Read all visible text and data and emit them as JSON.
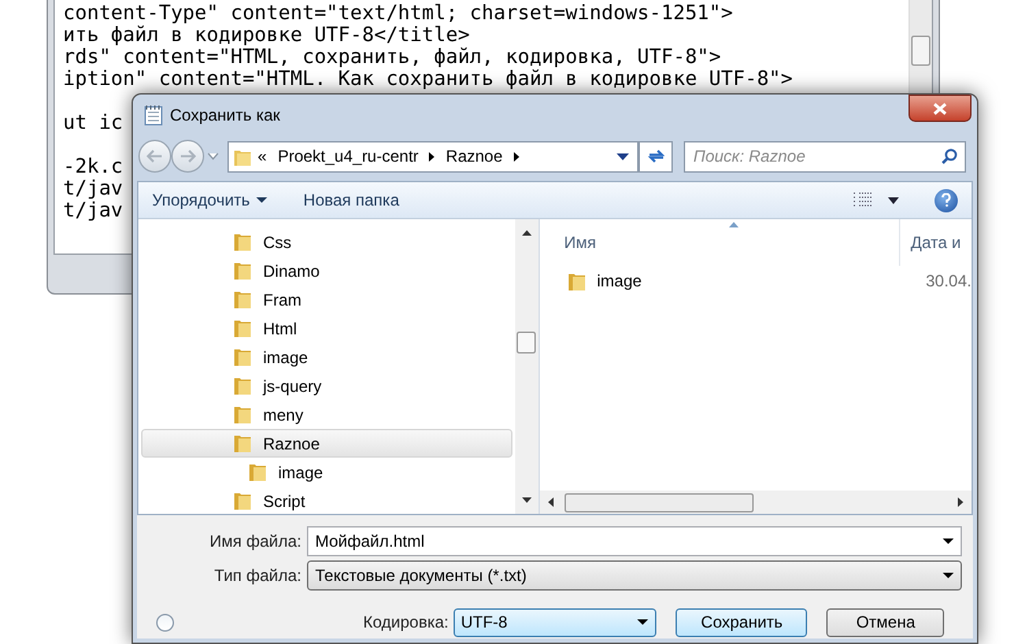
{
  "editor": {
    "lines": [
      {
        "kind": "code",
        "text": "content-Type\" content=\"text/html; charset=windows-1251\">"
      },
      {
        "kind": "code",
        "text": "ить файл в кодировке UTF-8</title>"
      },
      {
        "kind": "code",
        "text": "rds\" content=\"HTML, сохранить, файл, кодировка, UTF-8\">"
      },
      {
        "kind": "code",
        "text": "iption\" content=\"HTML. Как сохранить файл в кодировке UTF-8\">"
      },
      {
        "kind": "blank"
      },
      {
        "kind": "code",
        "text": "ut ic"
      },
      {
        "kind": "blank"
      },
      {
        "kind": "code",
        "text": "-2k.c"
      },
      {
        "kind": "code",
        "text": "t/jav"
      },
      {
        "kind": "code",
        "text": "t/jav"
      }
    ]
  },
  "dialog": {
    "title": "Сохранить как",
    "address": {
      "overflow": "«",
      "crumbs": [
        "Proekt_u4_ru-centr",
        "Raznoe"
      ]
    },
    "search": {
      "placeholder": "Поиск: Raznoe"
    },
    "toolbar": {
      "buttons": [
        "Упорядочить",
        "Новая папка"
      ]
    },
    "tree": [
      {
        "label": "Css",
        "selected": false
      },
      {
        "label": "Dinamo",
        "selected": false
      },
      {
        "label": "Fram",
        "selected": false
      },
      {
        "label": "Html",
        "selected": false
      },
      {
        "label": "image",
        "selected": false
      },
      {
        "label": "js-query",
        "selected": false
      },
      {
        "label": "meny",
        "selected": false
      },
      {
        "label": "Raznoe",
        "selected": true,
        "children": [
          {
            "label": "image",
            "selected": false
          }
        ]
      },
      {
        "label": "Script",
        "selected": false
      }
    ],
    "files": {
      "columns": [
        "Имя",
        "Дата и"
      ],
      "rows": [
        {
          "name": "image",
          "date": "30.04."
        }
      ]
    },
    "file_name": {
      "label": "Имя файла:",
      "value": "Мойфайл.html"
    },
    "file_type": {
      "label": "Тип файла:",
      "value": "Текстовые документы (*.txt)"
    },
    "option_radio": {
      "checked": false
    },
    "encoding": {
      "label": "Кодировка:",
      "value": "UTF-8"
    },
    "buttons": [
      "Сохранить",
      "Отмена"
    ]
  }
}
